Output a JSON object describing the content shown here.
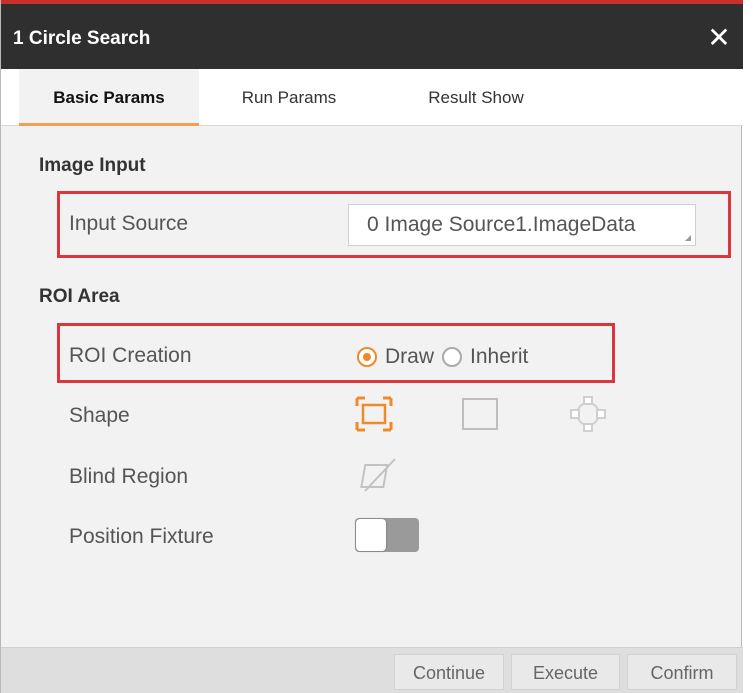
{
  "window": {
    "title": "1 Circle Search",
    "close_glyph": "✕"
  },
  "tabs": [
    {
      "label": "Basic Params",
      "active": true
    },
    {
      "label": "Run Params",
      "active": false
    },
    {
      "label": "Result Show",
      "active": false
    }
  ],
  "image_input": {
    "section_title": "Image Input",
    "input_source_label": "Input Source",
    "input_source_value": "0 Image Source1.ImageData"
  },
  "roi_area": {
    "section_title": "ROI Area",
    "roi_creation_label": "ROI Creation",
    "roi_options": [
      {
        "label": "Draw",
        "selected": true
      },
      {
        "label": "Inherit",
        "selected": false
      }
    ],
    "shape_label": "Shape",
    "shape_icons": [
      "roi-rect-handles-icon",
      "rectangle-icon",
      "annulus-icon"
    ],
    "blind_region_label": "Blind Region",
    "blind_region_icon": "no-mask-icon",
    "position_fixture_label": "Position Fixture",
    "position_fixture_on": false
  },
  "footer": {
    "continue_label": "Continue",
    "execute_label": "Execute",
    "confirm_label": "Confirm"
  },
  "colors": {
    "accent": "#f0892c",
    "highlight": "#d9363e",
    "titlebar": "#2f2f2f"
  }
}
